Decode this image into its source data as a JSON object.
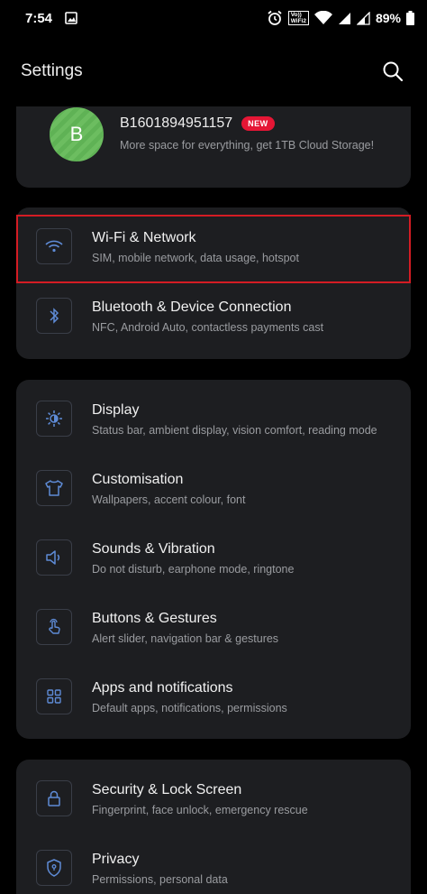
{
  "status_bar": {
    "time": "7:54",
    "volte_top": "Vo))",
    "volte_bottom": "WiFi2",
    "battery": "89%"
  },
  "header": {
    "title": "Settings"
  },
  "profile": {
    "avatar_letter": "B",
    "name": "B1601894951157",
    "badge": "NEW",
    "subtitle": "More space for everything, get 1TB Cloud Storage!"
  },
  "groups": [
    {
      "items": [
        {
          "label": "Wi-Fi & Network",
          "sub": "SIM, mobile network, data usage, hotspot",
          "icon": "wifi-icon"
        },
        {
          "label": "Bluetooth & Device Connection",
          "sub": "NFC, Android Auto, contactless payments cast",
          "icon": "bluetooth-icon"
        }
      ]
    },
    {
      "items": [
        {
          "label": "Display",
          "sub": "Status bar, ambient display, vision comfort, reading mode",
          "icon": "brightness-icon"
        },
        {
          "label": "Customisation",
          "sub": "Wallpapers, accent colour, font",
          "icon": "tshirt-icon"
        },
        {
          "label": "Sounds & Vibration",
          "sub": "Do not disturb, earphone mode, ringtone",
          "icon": "speaker-icon"
        },
        {
          "label": "Buttons & Gestures",
          "sub": "Alert slider, navigation bar & gestures",
          "icon": "gesture-icon"
        },
        {
          "label": "Apps and notifications",
          "sub": "Default apps, notifications, permissions",
          "icon": "apps-grid-icon"
        }
      ]
    },
    {
      "items": [
        {
          "label": "Security & Lock Screen",
          "sub": "Fingerprint, face unlock, emergency rescue",
          "icon": "lock-icon"
        },
        {
          "label": "Privacy",
          "sub": "Permissions, personal data",
          "icon": "shield-icon"
        }
      ]
    }
  ],
  "colors": {
    "accent": "#5e8bd6",
    "highlight_border": "#d41c24",
    "badge": "#e51635",
    "card_bg": "#1d1e21"
  }
}
